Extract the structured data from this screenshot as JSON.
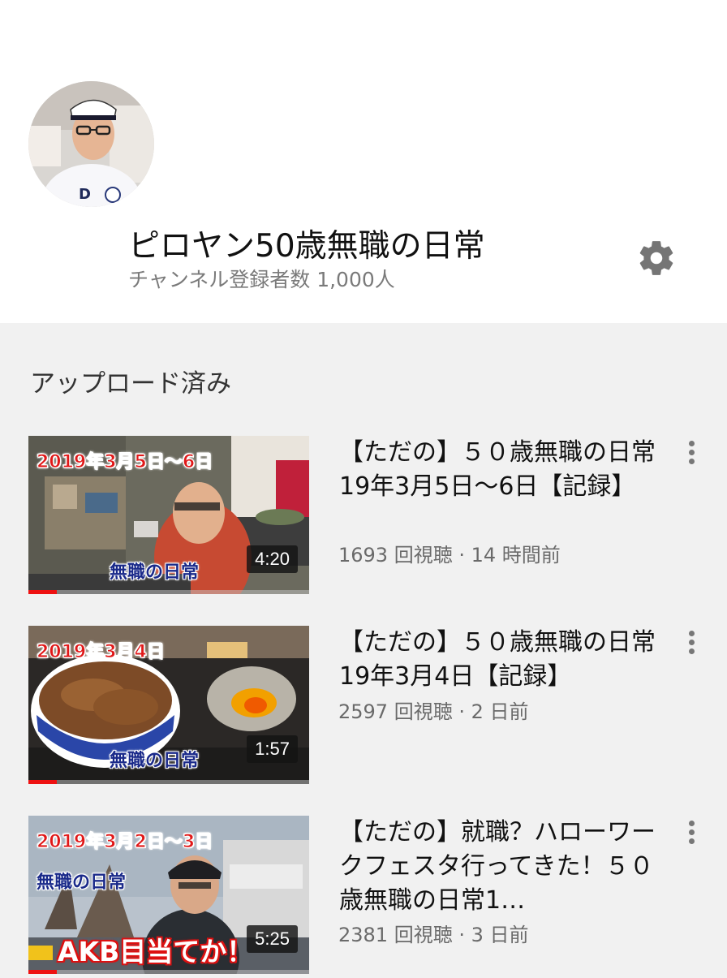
{
  "channel": {
    "name": "ピロヤン50歳無職の日常",
    "subscribers": "チャンネル登録者数 1,000人",
    "settings_icon": "gear-icon"
  },
  "section": {
    "title": "アップロード済み"
  },
  "videos": [
    {
      "title": "【ただの】５０歳無職の日常19年3月5日〜6日【記録】",
      "meta": "1693 回視聴 · 14 時間前",
      "duration": "4:20",
      "overlay_date": "2019年3月5日〜6日",
      "overlay_label": "無職の日常",
      "progress": 0.1
    },
    {
      "title": "【ただの】５０歳無職の日常19年3月4日【記録】",
      "meta": "2597 回視聴 · 2 日前",
      "duration": "1:57",
      "overlay_date": "2019年3月4日",
      "overlay_label": "無職の日常",
      "progress": 0.1
    },
    {
      "title": "【ただの】就職？ハローワークフェスタ行ってきた！５０歳無職の日常1…",
      "meta": "2381 回視聴 · 3 日前",
      "duration": "5:25",
      "overlay_date": "2019年3月2日〜3日",
      "overlay_label": "無職の日常",
      "overlay_extra": "AKB目当てか！",
      "progress": 0.1
    }
  ],
  "colors": {
    "header_bg": "#ffffff",
    "page_bg": "#f1f1f1",
    "progress": "#ee1111",
    "secondary_text": "#6a6a6a"
  }
}
